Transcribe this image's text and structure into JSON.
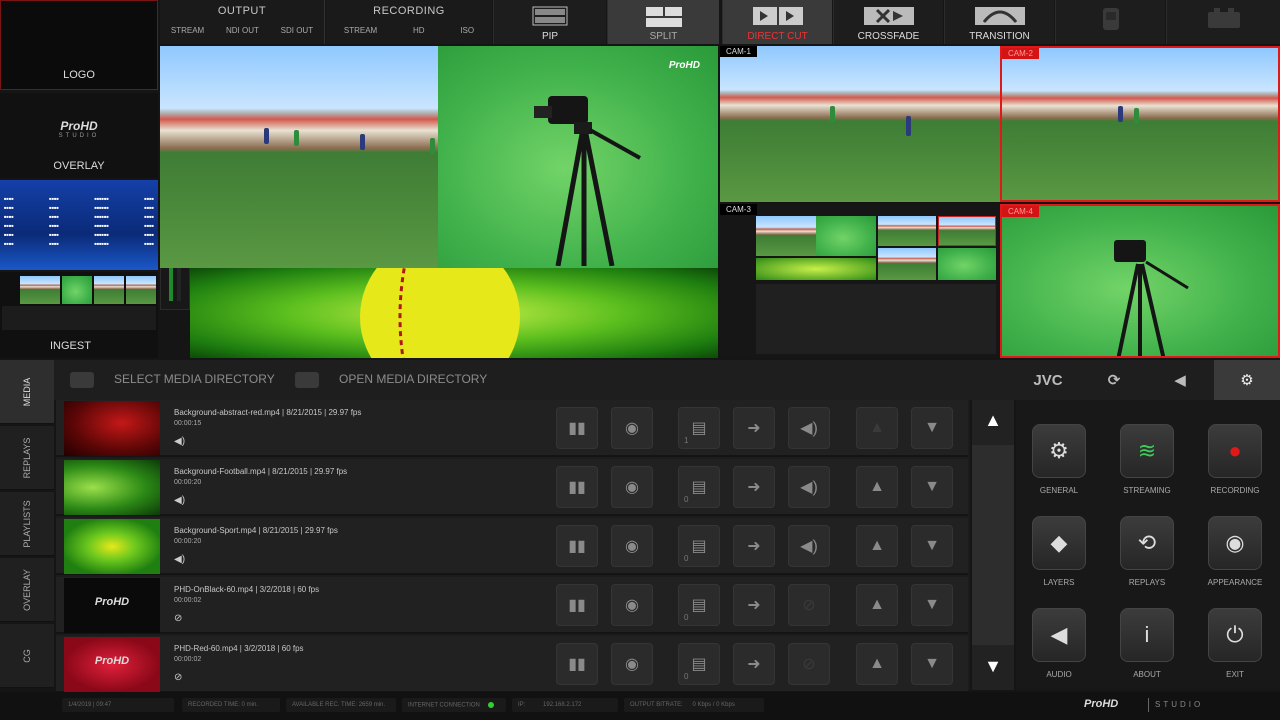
{
  "top_bar": {
    "logo_label": "LOGO",
    "output": {
      "title": "OUTPUT",
      "items": [
        "STREAM",
        "NDI OUT",
        "SDI OUT"
      ]
    },
    "recording": {
      "title": "RECORDING",
      "items": [
        "STREAM",
        "HD",
        "ISO"
      ]
    },
    "modes": [
      {
        "label": "PIP",
        "icon": "pip-icon"
      },
      {
        "label": "SPLIT",
        "icon": "split-icon",
        "active": true
      }
    ],
    "transitions": [
      {
        "label": "DIRECT CUT",
        "icon": "direct-cut-icon",
        "active": true
      },
      {
        "label": "CROSSFADE",
        "icon": "crossfade-icon"
      },
      {
        "label": "TRANSITION",
        "icon": "transition-icon"
      }
    ]
  },
  "left_column": {
    "overlay_brand": "ProHD",
    "overlay_brand_sub": "STUDIO",
    "overlay_label": "OVERLAY",
    "ingest_label": "INGEST"
  },
  "program": {
    "watermark": "ProHD"
  },
  "cameras": [
    {
      "label": "CAM-1",
      "live": false
    },
    {
      "label": "CAM-2",
      "live": true
    },
    {
      "label": "CAM-3",
      "live": false
    },
    {
      "label": "CAM-4",
      "live": true
    }
  ],
  "media_bar": {
    "select_dir": "SELECT MEDIA DIRECTORY",
    "open_dir": "OPEN MEDIA DIRECTORY",
    "brand": "JVC"
  },
  "side_tabs": [
    "MEDIA",
    "REPLAYS",
    "PLAYLISTS",
    "OVERLAY",
    "CG"
  ],
  "media_items": [
    {
      "title": "Background-abstract-red.mp4 | 8/21/2015 | 29.97 fps",
      "duration": "00:00:15",
      "audio": true,
      "count": "1"
    },
    {
      "title": "Background-Football.mp4 | 8/21/2015 | 29.97 fps",
      "duration": "00:00:20",
      "audio": true,
      "count": "0"
    },
    {
      "title": "Background-Sport.mp4 | 8/21/2015 | 29.97 fps",
      "duration": "00:00:20",
      "audio": true,
      "count": "0"
    },
    {
      "title": "PHD-OnBlack-60.mp4 | 3/2/2018 | 60 fps",
      "duration": "00:00:02",
      "audio": false,
      "count": "0"
    },
    {
      "title": "PHD-Red-60.mp4 | 3/2/2018 | 60 fps",
      "duration": "00:00:02",
      "audio": false,
      "count": "0"
    }
  ],
  "settings": [
    {
      "label": "GENERAL",
      "icon": "gear-icon"
    },
    {
      "label": "STREAMING",
      "icon": "streaming-icon"
    },
    {
      "label": "RECORDING",
      "icon": "record-icon"
    },
    {
      "label": "LAYERS",
      "icon": "layers-icon"
    },
    {
      "label": "REPLAYS",
      "icon": "replay-icon"
    },
    {
      "label": "APPEARANCE",
      "icon": "eye-icon"
    },
    {
      "label": "AUDIO",
      "icon": "audio-icon"
    },
    {
      "label": "ABOUT",
      "icon": "info-icon"
    },
    {
      "label": "EXIT",
      "icon": "power-icon"
    }
  ],
  "status": {
    "datetime": "1/4/2019 | 09:47",
    "recorded_time": "RECORDED TIME: 0 min.",
    "available_time": "AVAILABLE REC. TIME: 2659 min.",
    "internet": "INTERNET CONNECTION",
    "ip_label": "IP:",
    "ip": "192.168.2.172",
    "bitrate": "OUTPUT BITRATE:",
    "bitrate_value": "0 Kbps / 0 Kbps",
    "brand": "ProHD",
    "brand_sub": "STUDIO",
    "colors": {
      "online": "#2fd12f",
      "live_red": "#e01818"
    }
  }
}
